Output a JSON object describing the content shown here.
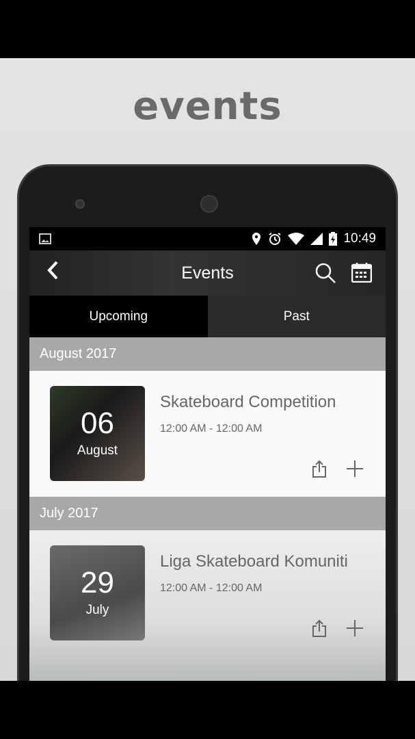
{
  "heading": "events",
  "status": {
    "time": "10:49",
    "icons": [
      "image-icon",
      "location-icon",
      "alarm-icon",
      "wifi-icon",
      "signal-icon",
      "battery-charging-icon"
    ]
  },
  "toolbar": {
    "title": "Events",
    "back": "back-icon",
    "search": "search-icon",
    "calendar": "calendar-icon"
  },
  "tabs": [
    {
      "label": "Upcoming",
      "active": true
    },
    {
      "label": "Past",
      "active": false
    }
  ],
  "sections": [
    {
      "header": "August 2017",
      "event": {
        "day": "06",
        "month": "August",
        "title": "Skateboard Competition",
        "time": "12:00 AM - 12:00 AM"
      }
    },
    {
      "header": "July 2017",
      "event": {
        "day": "29",
        "month": "July",
        "title": "Liga Skateboard Komuniti",
        "time": "12:00 AM - 12:00 AM"
      }
    }
  ]
}
